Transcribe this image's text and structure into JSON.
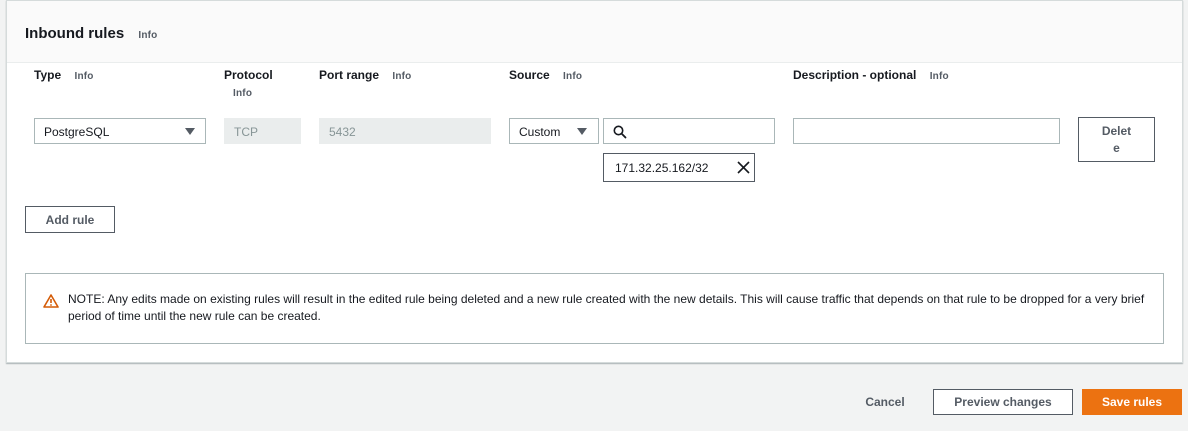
{
  "panel": {
    "title": "Inbound rules",
    "info": "Info"
  },
  "columns": {
    "type": "Type",
    "protocol": "Protocol",
    "port_range": "Port range",
    "source": "Source",
    "description": "Description - optional",
    "info": "Info"
  },
  "rule": {
    "type_value": "PostgreSQL",
    "protocol_value": "TCP",
    "port_range_value": "5432",
    "source_type": "Custom",
    "source_search_value": "",
    "source_token": "171.32.25.162/32",
    "description_value": "",
    "delete_label_line1": "Delet",
    "delete_label_line2": "e"
  },
  "add_rule_label": "Add rule",
  "note": {
    "text": "NOTE: Any edits made on existing rules will result in the edited rule being deleted and a new rule created with the new details. This will cause traffic that depends on that rule to be dropped for a very brief period of time until the new rule can be created."
  },
  "footer": {
    "cancel": "Cancel",
    "preview": "Preview changes",
    "save": "Save rules"
  },
  "colors": {
    "primary": "#ec7211",
    "warning": "#d45b07"
  }
}
